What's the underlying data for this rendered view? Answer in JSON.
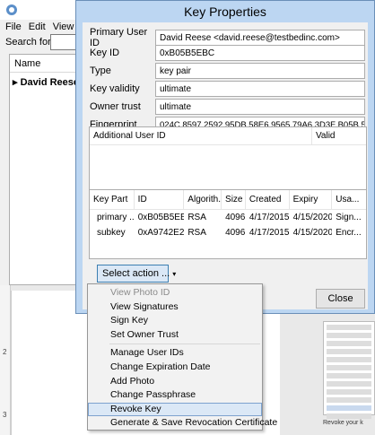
{
  "background": {
    "menu": [
      "File",
      "Edit",
      "View",
      "K"
    ],
    "search_label": "Search for:",
    "list_header": "Name",
    "list_row": "David Reese <d",
    "ruler_marks": [
      "2",
      "3"
    ],
    "side_caption": "Revoke your k"
  },
  "dialog": {
    "title": "Key Properties",
    "fields": {
      "primary_user_id": {
        "label": "Primary User ID",
        "value": "David Reese <david.reese@testbedinc.com>"
      },
      "key_id": {
        "label": "Key ID",
        "value": "0xB05B5EBC"
      },
      "type": {
        "label": "Type",
        "value": "key pair"
      },
      "key_validity": {
        "label": "Key validity",
        "value": "ultimate"
      },
      "owner_trust": {
        "label": "Owner trust",
        "value": "ultimate"
      },
      "fingerprint": {
        "label": "Fingerprint",
        "value": "024C 8597 2592 95DB 58E6 9565 79A6 3D3F B05B 5EBC"
      }
    },
    "uid_table": {
      "col1": "Additional User ID",
      "col2": "Valid"
    },
    "keypart_table": {
      "headers": [
        "Key Part",
        "ID",
        "Algorith...",
        "Size",
        "Created",
        "Expiry",
        "Usa..."
      ],
      "rows": [
        [
          "primary ...",
          "0xB05B5EBC",
          "RSA",
          "4096",
          "4/17/2015",
          "4/15/2020",
          "Sign..."
        ],
        [
          "subkey",
          "0xA9742E27",
          "RSA",
          "4096",
          "4/17/2015",
          "4/15/2020",
          "Encr..."
        ]
      ]
    },
    "select_action": "Select action ...",
    "close": "Close"
  },
  "menu": {
    "items": [
      "View Photo ID",
      "View Signatures",
      "Sign Key",
      "Set Owner Trust",
      "Manage User IDs",
      "Change Expiration Date",
      "Add Photo",
      "Change Passphrase",
      "Revoke Key",
      "Generate & Save Revocation Certificate"
    ]
  }
}
